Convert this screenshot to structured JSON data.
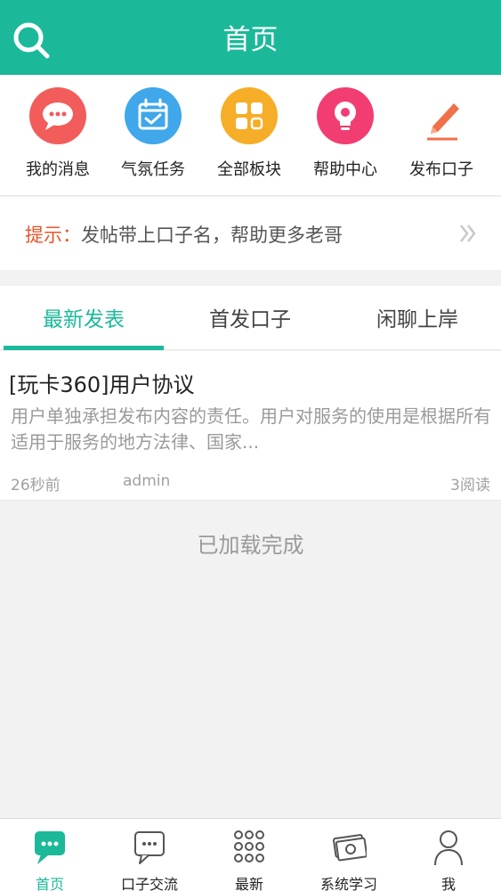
{
  "header": {
    "title": "首页",
    "search_icon": "search-icon"
  },
  "quick_menu": [
    {
      "label": "我的消息",
      "icon": "chat-bubble-icon",
      "color": "#f25c5a"
    },
    {
      "label": "气氛任务",
      "icon": "calendar-check-icon",
      "color": "#3fa7ea"
    },
    {
      "label": "全部板块",
      "icon": "grid-icon",
      "color": "#f6ad27"
    },
    {
      "label": "帮助中心",
      "icon": "lightbulb-icon",
      "color": "#f23d73"
    },
    {
      "label": "发布口子",
      "icon": "pencil-icon",
      "color": "#f07149"
    }
  ],
  "tip": {
    "prefix": "提示：",
    "text": "发帖带上口子名，帮助更多老哥",
    "prefix_color": "#e8562a"
  },
  "tabs": [
    {
      "label": "最新发表",
      "active": true
    },
    {
      "label": "首发口子",
      "active": false
    },
    {
      "label": "闲聊上岸",
      "active": false
    }
  ],
  "posts": [
    {
      "title": "[玩卡360]用户协议",
      "summary": "用户单独承担发布内容的责任。用户对服务的使用是根据所有适用于服务的地方法律、国家...",
      "time": "26秒前",
      "author": "admin",
      "reads": "3阅读"
    }
  ],
  "status_text": "已加载完成",
  "bottom_nav": [
    {
      "label": "首页",
      "icon": "home-chat-icon",
      "active": true
    },
    {
      "label": "口子交流",
      "icon": "chat-outline-icon",
      "active": false
    },
    {
      "label": "最新",
      "icon": "dots-grid-icon",
      "active": false
    },
    {
      "label": "系统学习",
      "icon": "money-icon",
      "active": false
    },
    {
      "label": "我",
      "icon": "person-icon",
      "active": false
    }
  ],
  "colors": {
    "accent": "#1bb99a",
    "background": "#f2f2f2"
  }
}
